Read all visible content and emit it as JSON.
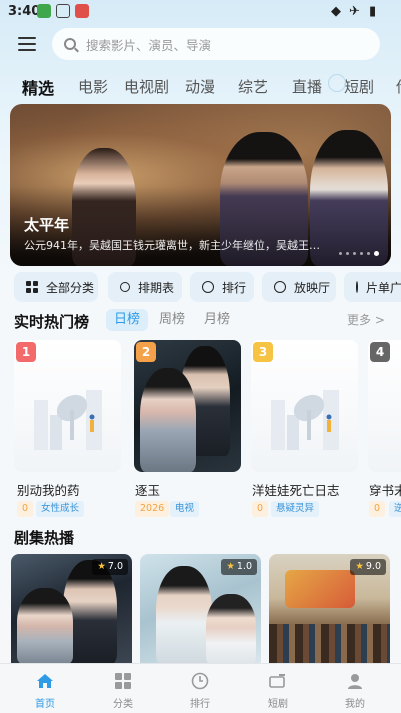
{
  "status_bar": {
    "time": "3:40"
  },
  "header": {
    "search_placeholder": "搜索影片、演员、导演"
  },
  "category_tabs": [
    "精选",
    "电影",
    "电视剧",
    "动漫",
    "综艺",
    "直播",
    "短剧",
    "传"
  ],
  "banner": {
    "title": "太平年",
    "description": "公元941年，吴越国王钱元瓘离世，新主少年继位，吴越王…"
  },
  "quick_buttons": [
    "全部分类",
    "排期表",
    "排行",
    "放映厅",
    "片单广"
  ],
  "hot_ranking": {
    "title": "实时热门榜",
    "tabs": [
      "日榜",
      "周榜",
      "月榜"
    ],
    "more": "更多 >",
    "items": [
      {
        "rank": "1",
        "name": "别动我的药",
        "tags": [
          "0",
          "女性成长"
        ]
      },
      {
        "rank": "2",
        "name": "逐玉",
        "tags": [
          "2026",
          "电视"
        ]
      },
      {
        "rank": "3",
        "name": "洋娃娃死亡日志",
        "tags": [
          "0",
          "悬疑灵异"
        ]
      },
      {
        "rank": "4",
        "name": "穿书末",
        "tags": [
          "0",
          "逆"
        ]
      }
    ]
  },
  "drama": {
    "title": "剧集热播",
    "items": [
      {
        "score": "7.0"
      },
      {
        "score": "1.0"
      },
      {
        "score": "9.0"
      }
    ]
  },
  "bottom_nav": [
    "首页",
    "分类",
    "排行",
    "短剧",
    "我的"
  ],
  "colors": {
    "accent": "#2e9be6",
    "rank_1": "#f26a6a",
    "rank_2": "#f5a14a",
    "rank_3": "#f6c343",
    "rank_4": "#666666"
  }
}
